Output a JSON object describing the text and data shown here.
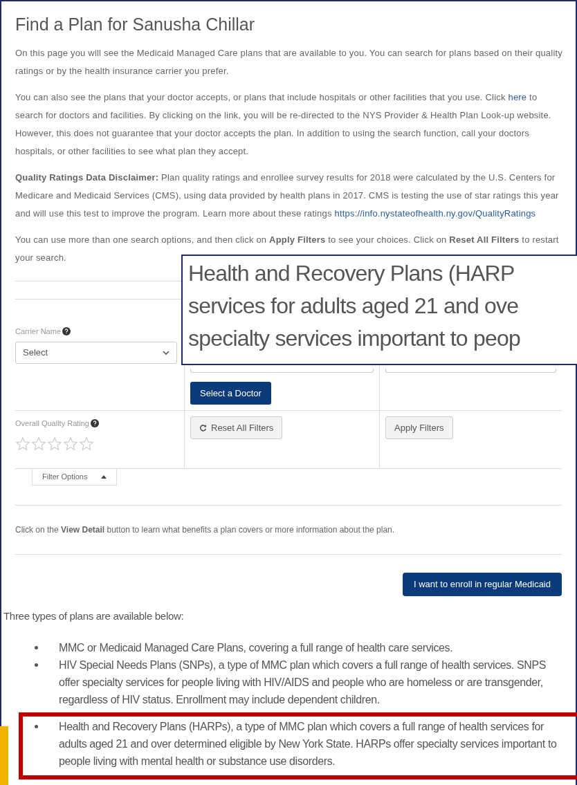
{
  "title": "Find a Plan for Sanusha  Chillar",
  "paragraphs": [
    [
      {
        "kind": "text",
        "text": "On this page you will see the Medicaid Managed Care plans that are available to you. You can search for plans based on their quality ratings or by the health insurance carrier you prefer."
      }
    ],
    [
      {
        "kind": "text",
        "text": "You can also see the plans that your doctor accepts, or plans that include hospitals or other facilities that you use. Click "
      },
      {
        "kind": "link",
        "text": "here"
      },
      {
        "kind": "text",
        "text": " to search for doctors and facilities. By clicking on the link, you will be re-directed to the NYS Provider & Health Plan Look-up website. However, this does not guarantee that your doctor accepts the plan. In addition to using the search function, call your doctors hospitals, or other facilities to see what plan they accept."
      }
    ],
    [
      {
        "kind": "text",
        "text": "**Quality Ratings Data Disclaimer:** Plan quality ratings and enrollee survey results for 2018 were calculated by the U.S. Centers for Medicare and Medicaid Services (CMS), using data provided by health plans in 2017. CMS is testing the use of star ratings this year and will use this test to improve the program. Learn more about these ratings "
      },
      {
        "kind": "link",
        "text": "https://info.nystateofhealth.ny.gov/QualityRatings"
      }
    ],
    [
      {
        "kind": "text",
        "text": "You can use more than one search options, and then click on **Apply Filters** to see your choices. Click on **Reset All Filters** to restart your search."
      }
    ]
  ],
  "filters": {
    "carrier": {
      "label": "Carrier Name",
      "value": "Select"
    },
    "doctor_button": "Select a Doctor",
    "rating": {
      "label": "Overall Quality Rating",
      "stars": 0
    },
    "reset_button": "Reset All Filters",
    "apply_button": "Apply Filters",
    "toggle": {
      "label": "Filter Options",
      "expanded": true
    }
  },
  "view_detail_note": "Click on the **View Detail** button to learn what benefits a plan covers or more information about the plan.",
  "enroll_button": "I want to enroll in regular Medicaid",
  "plan_types": {
    "intro": "Three types of plans are available below:",
    "items": [
      {
        "text": "MMC or Medicaid Managed Care Plans, covering a full range of health care services.",
        "highlighted": false
      },
      {
        "text": "HIV Special Needs Plans (SNPs), a type of MMC plan which covers a full range of health services.  SNPS offer specialty services for people living with HIV/AIDS and people who are homeless or are transgender, regardless of HIV status. Enrollment may include dependent children.",
        "highlighted": false
      },
      {
        "text": "Health and Recovery Plans (HARPs), a type of MMC plan which covers a full range of health services for adults aged 21 and over determined eligible by New York State.  HARPs offer specialty services important to people living with mental health or substance use disorders.",
        "highlighted": true
      }
    ]
  },
  "callout": {
    "lines": [
      "Health and Recovery Plans (HARP",
      "services for adults aged 21 and ove",
      "specialty services important to peop"
    ]
  }
}
